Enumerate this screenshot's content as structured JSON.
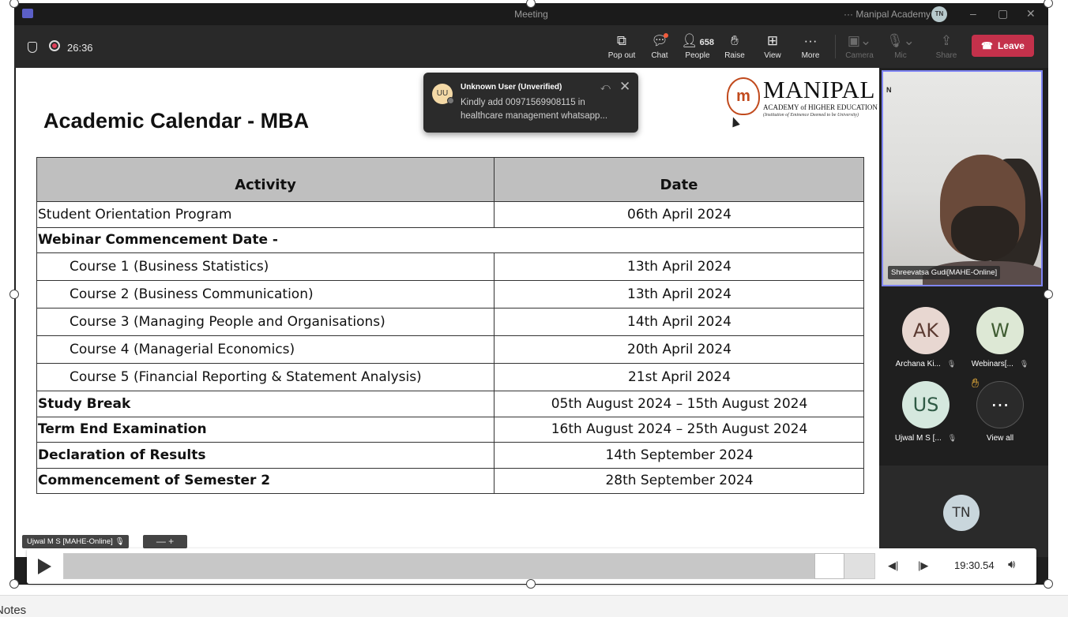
{
  "window": {
    "title": "Meeting",
    "org": "Manipal Academy",
    "avatar_initials": "TN",
    "more": "···",
    "minimize": "–",
    "restore": "▢",
    "close": "✕"
  },
  "toolbar": {
    "timer": "26:36",
    "buttons": {
      "popout": "Pop out",
      "chat": "Chat",
      "people": "People",
      "people_count": "658",
      "raise": "Raise",
      "view": "View",
      "more": "More",
      "camera": "Camera",
      "mic": "Mic",
      "share": "Share"
    },
    "leave": "Leave"
  },
  "slide": {
    "title": "Academic Calendar - MBA",
    "logo": {
      "name": "MANIPAL",
      "line1": "ACADEMY of HIGHER EDUCATION",
      "line2": "(Institution of Eminence Deemed to be University)"
    },
    "table": {
      "headers": [
        "Activity",
        "Date"
      ],
      "rows": [
        {
          "activity": "Student Orientation Program",
          "date": "06th April 2024"
        },
        {
          "activity": "Webinar Commencement Date -",
          "date": ""
        },
        {
          "activity": "Course 1 (Business Statistics)",
          "date": "13th April 2024"
        },
        {
          "activity": "Course 2 (Business Communication)",
          "date": "13th April 2024"
        },
        {
          "activity": "Course 3 (Managing People and Organisations)",
          "date": "14th April 2024"
        },
        {
          "activity": "Course 4 (Managerial Economics)",
          "date": "20th April 2024"
        },
        {
          "activity": "Course 5 (Financial Reporting & Statement Analysis)",
          "date": "21st April 2024"
        },
        {
          "activity": "Study Break",
          "date": "05th August 2024 – 15th August 2024"
        },
        {
          "activity": "Term End Examination",
          "date": "16th August 2024 – 25th August 2024"
        },
        {
          "activity": "Declaration of Results",
          "date": "14th September 2024"
        },
        {
          "activity": "Commencement of Semester 2",
          "date": "28th September 2024"
        }
      ]
    }
  },
  "toast": {
    "avatar": "UU",
    "from": "Unknown User (Unverified)",
    "message": "Kindly add 00971569908115 in healthcare management whatsapp..."
  },
  "participants": {
    "speaker_name": "Shreevatsa Gudi[MAHE-Online]",
    "tiles": [
      {
        "initials": "AK",
        "name": "Archana Ki...",
        "color": "#e8d7d1",
        "text_color": "#5c3b32"
      },
      {
        "initials": "W",
        "name": "Webinars[...",
        "color": "#dde8d5",
        "text_color": "#3f5c32"
      },
      {
        "initials": "US",
        "name": "Ujwal M S [...",
        "color": "#d5e8de",
        "text_color": "#2f5a45"
      },
      {
        "initials": "···",
        "name": "View all",
        "color": "#2a2a2a",
        "text_color": "#ffffff"
      }
    ],
    "self_initials": "TN"
  },
  "presenter_tag": "Ujwal M S [MAHE-Online]",
  "zoom_controls": "—  +",
  "player": {
    "time": "19:30.54",
    "progress": 0.96
  },
  "host": {
    "notes": "Notes"
  }
}
